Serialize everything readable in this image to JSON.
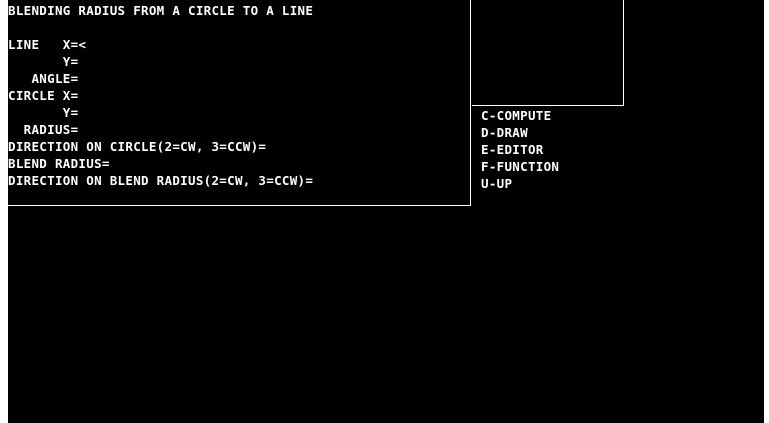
{
  "title": "BLENDING RADIUS FROM A CIRCLE TO A LINE",
  "form": {
    "line_label": "LINE",
    "line_x_label": "X=",
    "line_x_value": "<",
    "line_y_label": "Y=",
    "line_angle_label": "ANGLE=",
    "circle_label": "CIRCLE",
    "circle_x_label": "X=",
    "circle_y_label": "Y=",
    "circle_radius_label": "RADIUS=",
    "circle_direction_label": "DIRECTION ON CIRCLE(2=CW, 3=CCW)=",
    "blend_radius_label": "BLEND RADIUS=",
    "blend_direction_label": "DIRECTION ON BLEND RADIUS(2=CW, 3=CCW)="
  },
  "menu": [
    {
      "label": "C-COMPUTE"
    },
    {
      "label": "D-DRAW"
    },
    {
      "label": "E-EDITOR"
    },
    {
      "label": "F-FUNCTION"
    },
    {
      "label": "U-UP"
    }
  ],
  "colors": {
    "background": "#000000",
    "text": "#ffffff",
    "border": "#ffffff"
  }
}
